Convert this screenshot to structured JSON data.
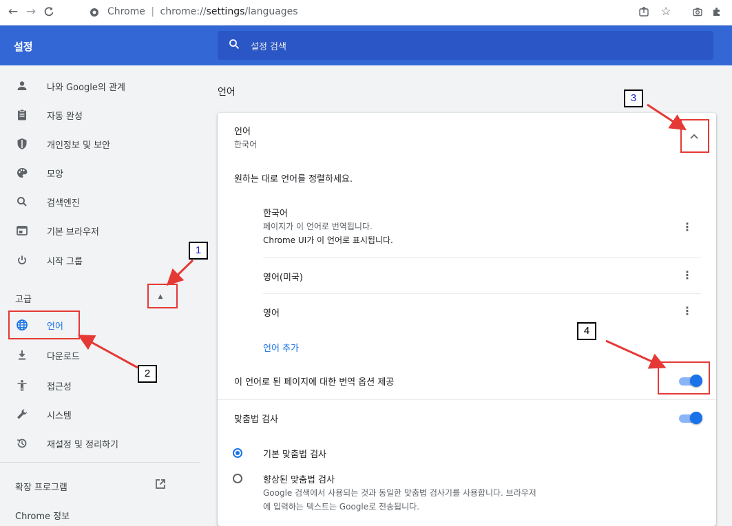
{
  "browser": {
    "omnibox_site": "Chrome",
    "omnibox_sep": "|",
    "omnibox_scheme": "chrome://",
    "omnibox_path": "settings",
    "omnibox_rest": "/languages"
  },
  "header": {
    "title": "설정",
    "search_placeholder": "설정 검색",
    "color": "#3367d6"
  },
  "sidebar": {
    "items": [
      {
        "label": "나와 Google의 관계",
        "icon": "person-icon"
      },
      {
        "label": "자동 완성",
        "icon": "clipboard-icon"
      },
      {
        "label": "개인정보 및 보안",
        "icon": "shield-icon"
      },
      {
        "label": "모양",
        "icon": "palette-icon"
      },
      {
        "label": "검색엔진",
        "icon": "search-icon"
      },
      {
        "label": "기본 브라우저",
        "icon": "browser-icon"
      },
      {
        "label": "시작 그룹",
        "icon": "power-icon"
      }
    ],
    "advanced_label": "고급",
    "advanced_items": [
      {
        "label": "언어",
        "icon": "globe-icon",
        "active": true
      },
      {
        "label": "다운로드",
        "icon": "download-icon"
      },
      {
        "label": "접근성",
        "icon": "accessibility-icon"
      },
      {
        "label": "시스템",
        "icon": "wrench-icon"
      },
      {
        "label": "재설정 및 정리하기",
        "icon": "restore-icon"
      }
    ],
    "extensions_label": "확장 프로그램",
    "about_label": "Chrome 정보"
  },
  "main": {
    "section_title": "언어",
    "language_header": "언어",
    "current_language": "한국어",
    "order_hint": "원하는 대로 언어를 정렬하세요.",
    "languages": [
      {
        "name": "한국어",
        "line1": "페이지가 이 언어로 번역됩니다.",
        "line2": "Chrome UI가 이 언어로 표시됩니다."
      },
      {
        "name": "영어(미국)"
      },
      {
        "name": "영어"
      }
    ],
    "add_language": "언어 추가",
    "translate_offer": "이 언어로 된 페이지에 대한 번역 옵션 제공",
    "spellcheck": "맞춤법 검사",
    "basic_spellcheck": "기본 맞춤법 검사",
    "enhanced_spellcheck": "향상된 맞춤법 검사",
    "enhanced_desc1": "Google 검색에서 사용되는 것과 동일한 맞춤법 검사기를 사용합니다. 브라우저",
    "enhanced_desc2": "에 입력하는 텍스트는 Google로 전송됩니다.",
    "translate_toggle_on": true,
    "spellcheck_toggle_on": true,
    "spellcheck_mode": "basic"
  },
  "annotations": {
    "n1": "1",
    "n2": "2",
    "n3": "3",
    "n4": "4",
    "arrow_color": "#e53935"
  }
}
